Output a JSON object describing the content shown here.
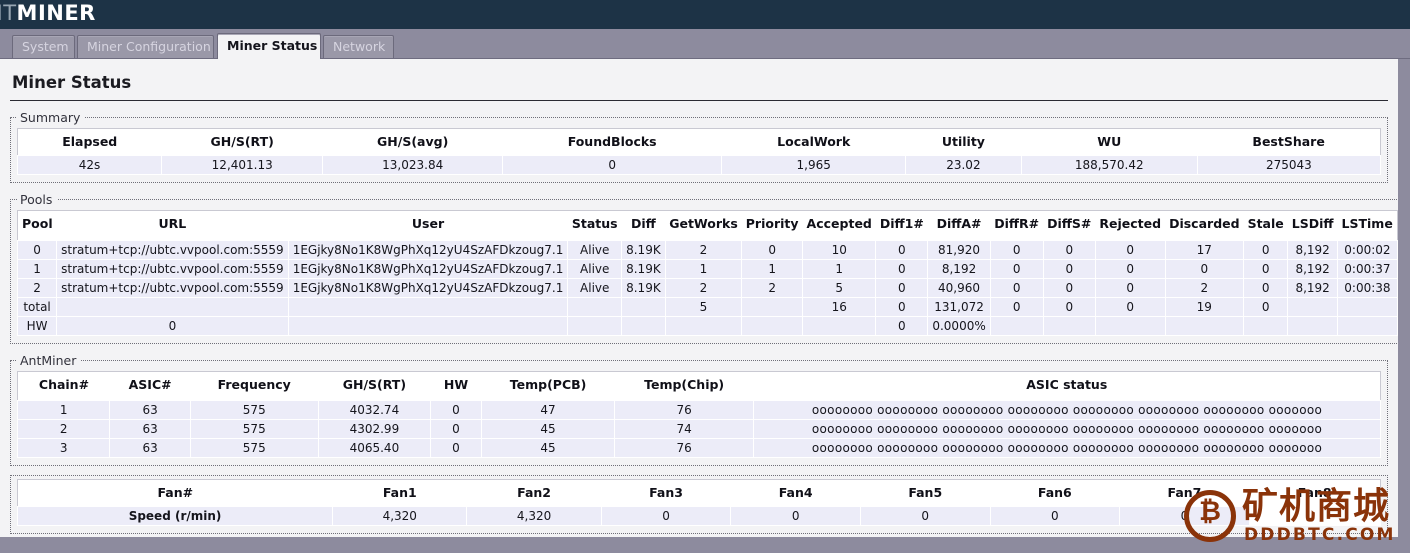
{
  "banner": {
    "logo_dim": "NT",
    "logo_bright": "MINER"
  },
  "tabs": [
    {
      "label": "System",
      "active": false
    },
    {
      "label": "Miner Configuration",
      "active": false
    },
    {
      "label": "Miner Status",
      "active": true
    },
    {
      "label": "Network",
      "active": false
    }
  ],
  "page_title": "Miner Status",
  "summary": {
    "legend": "Summary",
    "headers": [
      "Elapsed",
      "GH/S(RT)",
      "GH/S(avg)",
      "FoundBlocks",
      "LocalWork",
      "Utility",
      "WU",
      "BestShare"
    ],
    "values": [
      "42s",
      "12,401.13",
      "13,023.84",
      "0",
      "1,965",
      "23.02",
      "188,570.42",
      "275043"
    ]
  },
  "pools": {
    "legend": "Pools",
    "headers": [
      "Pool",
      "URL",
      "User",
      "Status",
      "Diff",
      "GetWorks",
      "Priority",
      "Accepted",
      "Diff1#",
      "DiffA#",
      "DiffR#",
      "DiffS#",
      "Rejected",
      "Discarded",
      "Stale",
      "LSDiff",
      "LSTime"
    ],
    "rows": [
      [
        "0",
        "stratum+tcp://ubtc.vvpool.com:5559",
        "1EGjky8No1K8WgPhXq12yU4SzAFDkzoug7.1",
        "Alive",
        "8.19K",
        "2",
        "0",
        "10",
        "0",
        "81,920",
        "0",
        "0",
        "0",
        "17",
        "0",
        "8,192",
        "0:00:02"
      ],
      [
        "1",
        "stratum+tcp://ubtc.vvpool.com:5559",
        "1EGjky8No1K8WgPhXq12yU4SzAFDkzoug7.1",
        "Alive",
        "8.19K",
        "1",
        "1",
        "1",
        "0",
        "8,192",
        "0",
        "0",
        "0",
        "0",
        "0",
        "8,192",
        "0:00:37"
      ],
      [
        "2",
        "stratum+tcp://ubtc.vvpool.com:5559",
        "1EGjky8No1K8WgPhXq12yU4SzAFDkzoug7.1",
        "Alive",
        "8.19K",
        "2",
        "2",
        "5",
        "0",
        "40,960",
        "0",
        "0",
        "0",
        "2",
        "0",
        "8,192",
        "0:00:38"
      ],
      [
        "total",
        "",
        "",
        "",
        "",
        "5",
        "",
        "16",
        "0",
        "131,072",
        "0",
        "0",
        "0",
        "19",
        "0",
        "",
        ""
      ],
      [
        "HW",
        "0",
        "",
        "",
        "",
        "",
        "",
        "",
        "0",
        "0.0000%",
        "",
        "",
        "",
        "",
        "",
        "",
        ""
      ]
    ]
  },
  "antminer": {
    "legend": "AntMiner",
    "headers": [
      "Chain#",
      "ASIC#",
      "Frequency",
      "GH/S(RT)",
      "HW",
      "Temp(PCB)",
      "Temp(Chip)",
      "ASIC status"
    ],
    "rows": [
      [
        "1",
        "63",
        "575",
        "4032.74",
        "0",
        "47",
        "76",
        "oooooooo oooooooo oooooooo oooooooo oooooooo oooooooo oooooooo ooooooo"
      ],
      [
        "2",
        "63",
        "575",
        "4302.99",
        "0",
        "45",
        "74",
        "oooooooo oooooooo oooooooo oooooooo oooooooo oooooooo oooooooo ooooooo"
      ],
      [
        "3",
        "63",
        "575",
        "4065.40",
        "0",
        "45",
        "76",
        "oooooooo oooooooo oooooooo oooooooo oooooooo oooooooo oooooooo ooooooo"
      ]
    ]
  },
  "fans": {
    "headers": [
      "Fan#",
      "Fan1",
      "Fan2",
      "Fan3",
      "Fan4",
      "Fan5",
      "Fan6",
      "Fan7",
      "Fan8"
    ],
    "row_label": "Speed (r/min)",
    "values": [
      "4,320",
      "4,320",
      "0",
      "0",
      "0",
      "0",
      "0",
      ""
    ]
  },
  "watermark": {
    "badge_glyph": "₿",
    "chinese": "矿机商城",
    "url": "DDDBTC.COM"
  },
  "colors": {
    "banner_bg": "#1d3346",
    "chrome_bg": "#8d8b9e",
    "content_bg": "#f3f3f5",
    "row_bg": "#ececf8",
    "watermark": "#8a3309"
  }
}
